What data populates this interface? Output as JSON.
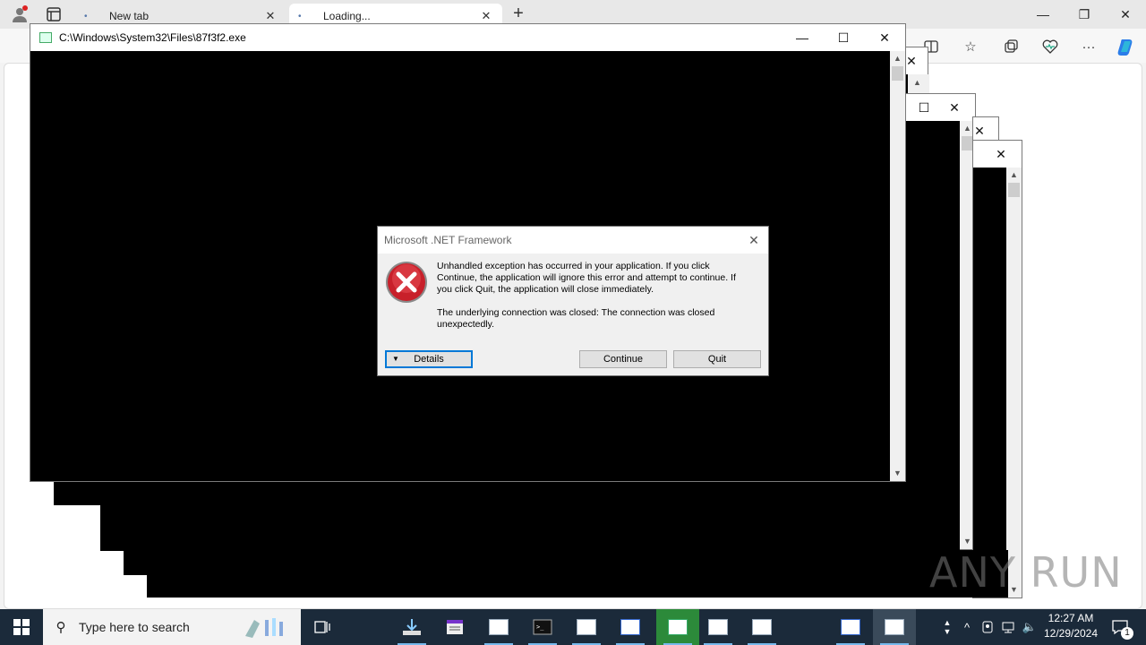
{
  "browser": {
    "tabs": [
      {
        "label": "New tab",
        "active": false
      },
      {
        "label": "Loading...",
        "active": true
      }
    ],
    "new_tab_symbol": "+",
    "toolbar_icons": [
      "split-screen-icon",
      "favorites-icon",
      "collections-icon",
      "browser-essentials-icon",
      "more-icon",
      "copilot-icon"
    ]
  },
  "console_window": {
    "title": "C:\\Windows\\System32\\Files\\87f3f2.exe"
  },
  "dialog": {
    "title": "Microsoft .NET Framework",
    "message_1": "Unhandled exception has occurred in your application. If you click Continue, the application will ignore this error and attempt to continue. If you click Quit, the application will close immediately.",
    "message_2": "The underlying connection was closed: The connection was closed unexpectedly.",
    "details_label": "Details",
    "continue_label": "Continue",
    "quit_label": "Quit"
  },
  "watermark": "ANY RUN",
  "taskbar": {
    "search_placeholder": "Type here to search",
    "time": "12:27 AM",
    "date": "12/29/2024",
    "notification_count": "1"
  },
  "colors": {
    "console_bg": "#000000",
    "taskbar_bg": "#1b2a3a",
    "focus_accent": "#0078d7",
    "error_red": "#c8202a"
  }
}
